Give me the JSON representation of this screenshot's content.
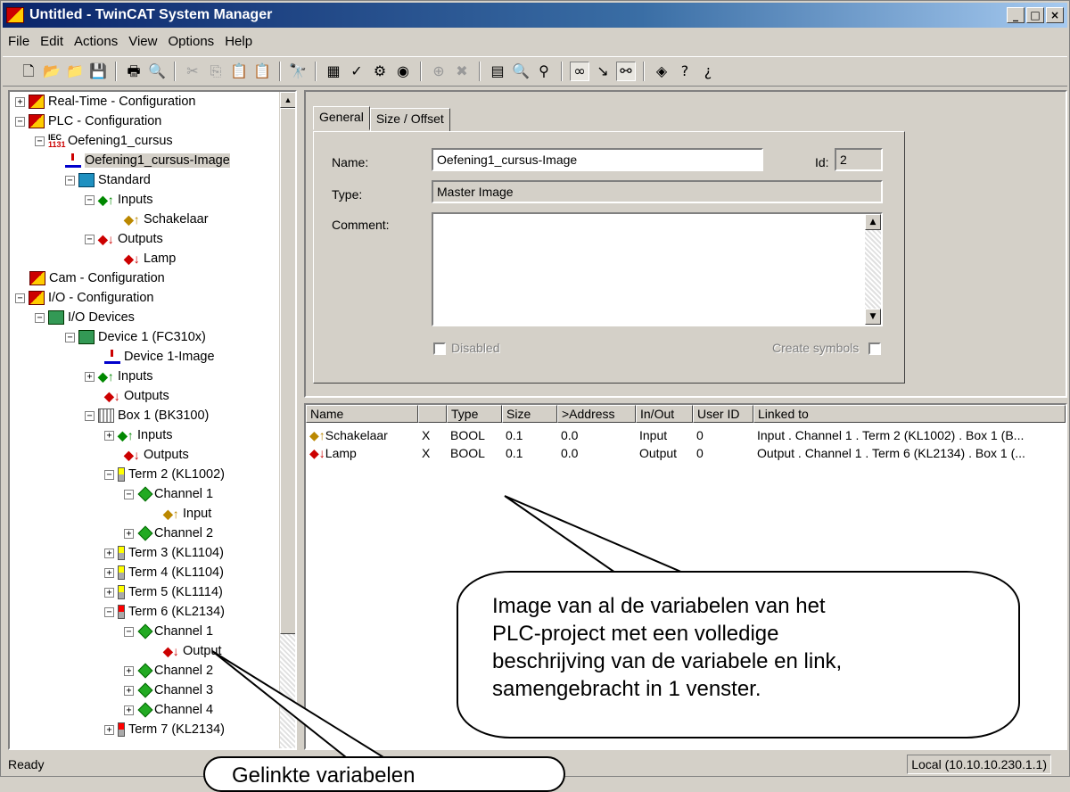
{
  "window": {
    "title": "Untitled - TwinCAT System Manager"
  },
  "title_buttons": {
    "minimize": "_",
    "maximize": "□",
    "close": "×"
  },
  "menu": [
    "File",
    "Edit",
    "Actions",
    "View",
    "Options",
    "Help"
  ],
  "toolbar_icons": [
    "new-icon",
    "open-icon",
    "open-folder-icon",
    "save-icon",
    "print-icon",
    "print-preview-icon",
    "cut-icon",
    "copy-icon",
    "paste-icon",
    "paste-special-icon",
    "find-icon",
    "generate-mappings-icon",
    "check-configuration-icon",
    "activate-configuration-icon",
    "set-run-mode-icon",
    "append-device-icon",
    "delete-icon",
    "properties-icon",
    "scan-icon",
    "online-icon",
    "free-run-icon",
    "show-online-icon",
    "link-icon",
    "plc-icon",
    "help-icon",
    "context-help-icon"
  ],
  "tree": [
    {
      "label": "Real-Time - Configuration",
      "exp": "+"
    },
    {
      "label": "PLC - Configuration",
      "exp": "−"
    },
    {
      "label": "Oefening1_cursus",
      "exp": "−"
    },
    {
      "label": "Oefening1_cursus-Image",
      "exp": ""
    },
    {
      "label": "Standard",
      "exp": "−"
    },
    {
      "label": "Inputs",
      "exp": "−"
    },
    {
      "label": "Schakelaar",
      "exp": ""
    },
    {
      "label": "Outputs",
      "exp": "−"
    },
    {
      "label": "Lamp",
      "exp": ""
    },
    {
      "label": "Cam - Configuration",
      "exp": ""
    },
    {
      "label": "I/O - Configuration",
      "exp": "−"
    },
    {
      "label": "I/O Devices",
      "exp": "−"
    },
    {
      "label": "Device 1 (FC310x)",
      "exp": "−"
    },
    {
      "label": "Device 1-Image",
      "exp": ""
    },
    {
      "label": "Inputs",
      "exp": "+"
    },
    {
      "label": "Outputs",
      "exp": ""
    },
    {
      "label": "Box 1 (BK3100)",
      "exp": "−"
    },
    {
      "label": "Inputs",
      "exp": "+"
    },
    {
      "label": "Outputs",
      "exp": ""
    },
    {
      "label": "Term 2 (KL1002)",
      "exp": "−"
    },
    {
      "label": "Channel 1",
      "exp": "−"
    },
    {
      "label": "Input",
      "exp": ""
    },
    {
      "label": "Channel 2",
      "exp": "+"
    },
    {
      "label": "Term 3 (KL1104)",
      "exp": "+"
    },
    {
      "label": "Term 4 (KL1104)",
      "exp": "+"
    },
    {
      "label": "Term 5 (KL1114)",
      "exp": "+"
    },
    {
      "label": "Term 6 (KL2134)",
      "exp": "−"
    },
    {
      "label": "Channel 1",
      "exp": "−"
    },
    {
      "label": "Output",
      "exp": ""
    },
    {
      "label": "Channel 2",
      "exp": "+"
    },
    {
      "label": "Channel 3",
      "exp": "+"
    },
    {
      "label": "Channel 4",
      "exp": "+"
    },
    {
      "label": "Term 7 (KL2134)",
      "exp": "+"
    }
  ],
  "tabs": [
    "General",
    "Size / Offset"
  ],
  "form": {
    "name_label": "Name:",
    "name_value": "Oefening1_cursus-Image",
    "id_label": "Id:",
    "id_value": "2",
    "type_label": "Type:",
    "type_value": "Master Image",
    "comment_label": "Comment:",
    "comment_value": "",
    "disabled_label": "Disabled",
    "create_symbols_label": "Create symbols"
  },
  "list": {
    "columns": [
      "Name",
      "",
      "Type",
      "Size",
      ">Address",
      "In/Out",
      "User ID",
      "Linked to"
    ],
    "rows": [
      [
        "Schakelaar",
        "X",
        "BOOL",
        "0.1",
        "0.0",
        "Input",
        "0",
        "Input . Channel 1 . Term 2 (KL1002) . Box 1 (B..."
      ],
      [
        "Lamp",
        "X",
        "BOOL",
        "0.1",
        "0.0",
        "Output",
        "0",
        "Output . Channel 1 . Term 6 (KL2134) . Box 1 (..."
      ]
    ]
  },
  "status": {
    "left": "Ready",
    "right": "Local (10.10.10.230.1.1)"
  },
  "callouts": {
    "big_lines": [
      "Image van al de variabelen van het",
      "PLC-project met een volledige",
      "beschrijving van de variabele en link,",
      "samengebracht in 1 venster."
    ],
    "small": "Gelinkte variabelen"
  }
}
